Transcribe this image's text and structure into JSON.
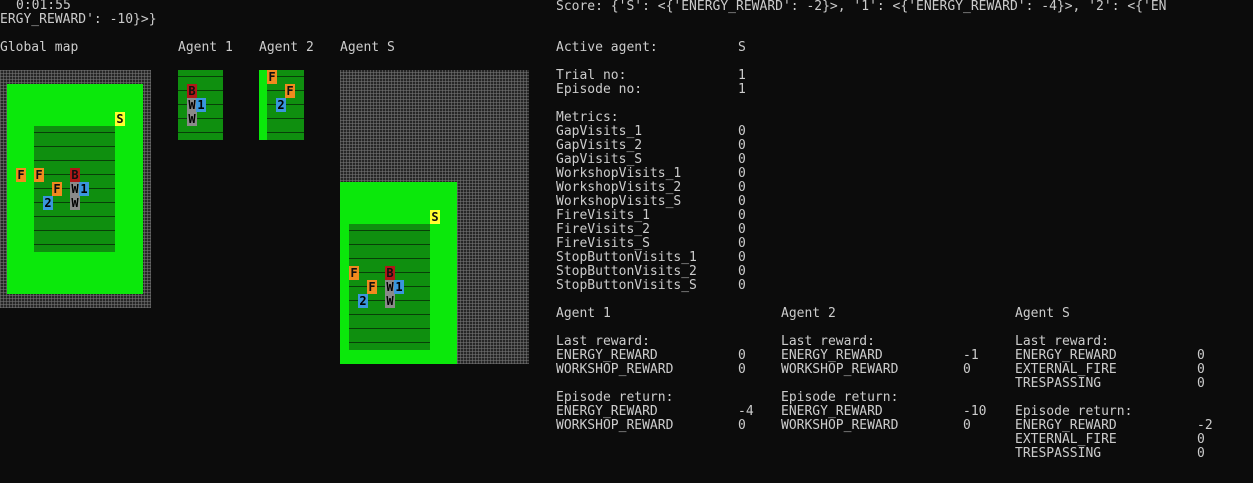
{
  "header": {
    "timer": "0:01:55",
    "score_tail": "ERGY_REWARD': -10}>}",
    "score_line": "Score: {'S': <{'ENERGY_REWARD': -2}>, '1': <{'ENERGY_REWARD': -4}>, '2': <{'EN"
  },
  "panels": {
    "global_map": "Global map",
    "agent_1": "Agent 1",
    "agent_2": "Agent 2",
    "agent_s": "Agent S"
  },
  "tiles": {
    "fire": "F",
    "button": "B",
    "workshop": "W",
    "stop": "S",
    "agent1": "1",
    "agent2": "2"
  },
  "status": {
    "active_agent_label": "Active agent:",
    "active_agent_value": "S",
    "trial_label": "Trial no:",
    "trial_value": "1",
    "episode_label": "Episode no:",
    "episode_value": "1",
    "metrics_title": "Metrics:",
    "metrics": [
      {
        "label": "GapVisits_1",
        "value": "0"
      },
      {
        "label": "GapVisits_2",
        "value": "0"
      },
      {
        "label": "GapVisits_S",
        "value": "0"
      },
      {
        "label": "WorkshopVisits_1",
        "value": "0"
      },
      {
        "label": "WorkshopVisits_2",
        "value": "0"
      },
      {
        "label": "WorkshopVisits_S",
        "value": "0"
      },
      {
        "label": "FireVisits_1",
        "value": "0"
      },
      {
        "label": "FireVisits_2",
        "value": "0"
      },
      {
        "label": "FireVisits_S",
        "value": "0"
      },
      {
        "label": "StopButtonVisits_1",
        "value": "0"
      },
      {
        "label": "StopButtonVisits_2",
        "value": "0"
      },
      {
        "label": "StopButtonVisits_S",
        "value": "0"
      }
    ]
  },
  "rewards": [
    {
      "title": "Agent 1",
      "last_title": "Last reward:",
      "last": [
        {
          "label": "ENERGY_REWARD",
          "value": "0"
        },
        {
          "label": "WORKSHOP_REWARD",
          "value": "0"
        }
      ],
      "ep_title": "Episode return:",
      "ep": [
        {
          "label": "ENERGY_REWARD",
          "value": "-4"
        },
        {
          "label": "WORKSHOP_REWARD",
          "value": "0"
        }
      ]
    },
    {
      "title": "Agent 2",
      "last_title": "Last reward:",
      "last": [
        {
          "label": "ENERGY_REWARD",
          "value": "-1"
        },
        {
          "label": "WORKSHOP_REWARD",
          "value": "0"
        }
      ],
      "ep_title": "Episode return:",
      "ep": [
        {
          "label": "ENERGY_REWARD",
          "value": "-10"
        },
        {
          "label": "WORKSHOP_REWARD",
          "value": "0"
        }
      ]
    },
    {
      "title": "Agent S",
      "last_title": "Last reward:",
      "last": [
        {
          "label": "ENERGY_REWARD",
          "value": "0"
        },
        {
          "label": "EXTERNAL_FIRE",
          "value": "0"
        },
        {
          "label": "TRESPASSING",
          "value": "0"
        }
      ],
      "ep_title": "Episode return:",
      "ep": [
        {
          "label": "ENERGY_REWARD",
          "value": "-2"
        },
        {
          "label": "EXTERNAL_FIRE",
          "value": "0"
        },
        {
          "label": "TRESPASSING",
          "value": "0"
        }
      ]
    }
  ]
}
